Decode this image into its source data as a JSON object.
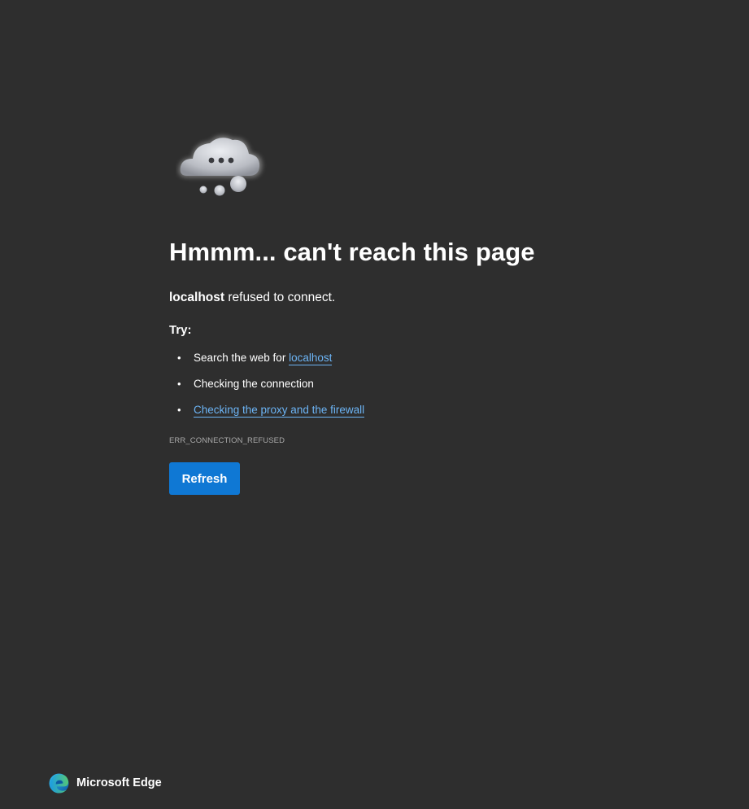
{
  "main": {
    "illustration_icon": "cloud-thinking-icon",
    "heading": "Hmmm... can't reach this page",
    "subtitle_host": "localhost",
    "subtitle_rest": " refused to connect.",
    "try_label": "Try:",
    "suggestions": [
      {
        "prefix": "Search the web for ",
        "link": "localhost"
      },
      {
        "text": "Checking the connection"
      },
      {
        "link": "Checking the proxy and the firewall"
      }
    ],
    "bullet_char": "•",
    "error_code": "ERR_CONNECTION_REFUSED",
    "refresh_label": "Refresh"
  },
  "footer": {
    "brand_icon": "edge-logo-icon",
    "brand_name": "Microsoft Edge"
  },
  "colors": {
    "background": "#2e2e2e",
    "link": "#6cb4f5",
    "button": "#0f78d4",
    "error_code": "#a9a9a9"
  }
}
